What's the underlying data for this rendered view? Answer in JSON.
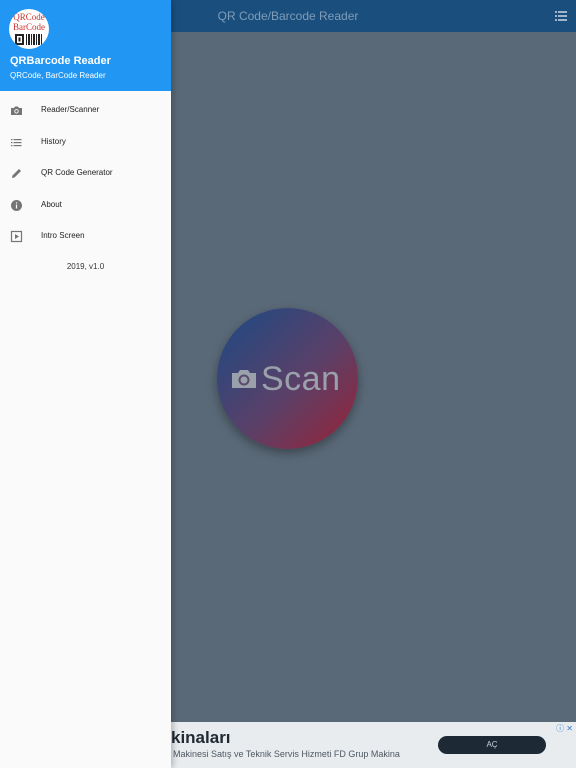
{
  "app_bar": {
    "title": "QR Code/Barcode Reader",
    "menu_icon": "list-icon"
  },
  "scan_button": {
    "label": "Scan",
    "icon": "camera-icon"
  },
  "drawer": {
    "avatar": {
      "line1": "QRCode",
      "line2": "BarCode"
    },
    "title": "QRBarcode Reader",
    "subtitle": "QRCode, BarCode Reader",
    "items": [
      {
        "label": "Reader/Scanner",
        "icon": "camera-icon"
      },
      {
        "label": "History",
        "icon": "list-icon"
      },
      {
        "label": "QR Code Generator",
        "icon": "pencil-icon"
      },
      {
        "label": "About",
        "icon": "info-icon"
      },
      {
        "label": "Intro Screen",
        "icon": "play-icon"
      }
    ],
    "version": "2019, v1.0"
  },
  "ad": {
    "title": "kinaları",
    "description": "Makinesi Satış ve Teknik Servis Hizmeti FD Grup Makina",
    "cta": "AÇ"
  },
  "colors": {
    "accent": "#2196f3",
    "app_bar": "#1a4f7d",
    "overlay": "#5a6978"
  }
}
